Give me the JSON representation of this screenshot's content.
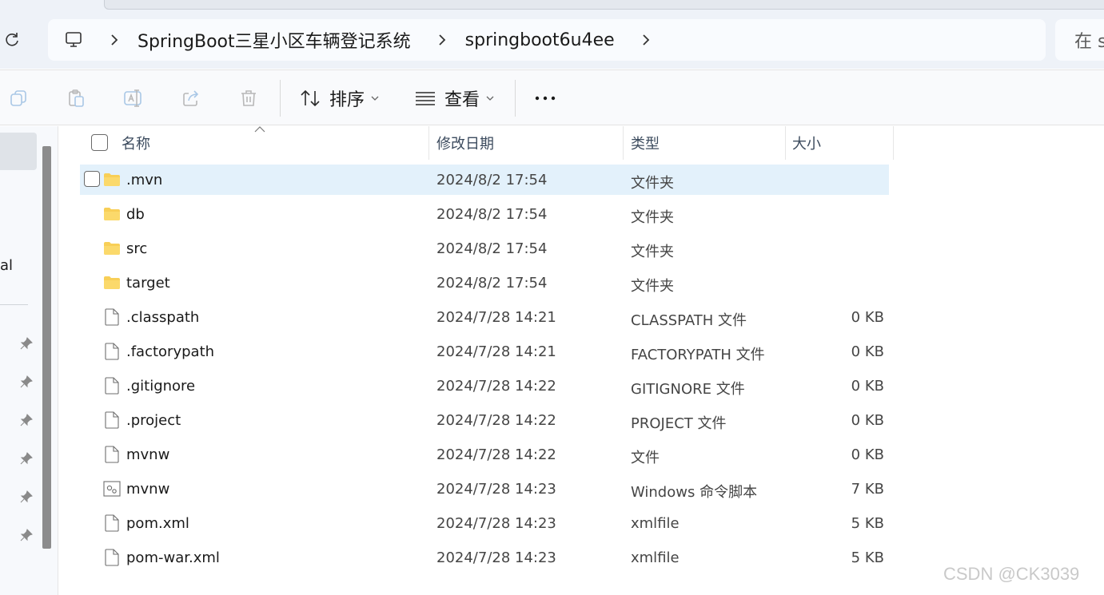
{
  "address": {
    "breadcrumbs": [
      "SpringBoot三星小区车辆登记系统",
      "springboot6u4ee"
    ],
    "search_prefix": "在 s"
  },
  "toolbar": {
    "sort_label": "排序",
    "view_label": "查看",
    "more_label": "···"
  },
  "nav": {
    "partial_text": "al"
  },
  "columns": {
    "name": "名称",
    "date": "修改日期",
    "type": "类型",
    "size": "大小"
  },
  "files": [
    {
      "name": ".mvn",
      "date": "2024/8/2 17:54",
      "type": "文件夹",
      "size": "",
      "kind": "folder-icon",
      "selected": true
    },
    {
      "name": "db",
      "date": "2024/8/2 17:54",
      "type": "文件夹",
      "size": "",
      "kind": "folder-icon"
    },
    {
      "name": "src",
      "date": "2024/8/2 17:54",
      "type": "文件夹",
      "size": "",
      "kind": "folder-icon"
    },
    {
      "name": "target",
      "date": "2024/8/2 17:54",
      "type": "文件夹",
      "size": "",
      "kind": "folder-icon"
    },
    {
      "name": ".classpath",
      "date": "2024/7/28 14:21",
      "type": "CLASSPATH 文件",
      "size": "0 KB",
      "kind": "file-icon"
    },
    {
      "name": ".factorypath",
      "date": "2024/7/28 14:21",
      "type": "FACTORYPATH 文件",
      "size": "0 KB",
      "kind": "file-icon"
    },
    {
      "name": ".gitignore",
      "date": "2024/7/28 14:22",
      "type": "GITIGNORE 文件",
      "size": "0 KB",
      "kind": "file-icon"
    },
    {
      "name": ".project",
      "date": "2024/7/28 14:22",
      "type": "PROJECT 文件",
      "size": "0 KB",
      "kind": "file-icon"
    },
    {
      "name": "mvnw",
      "date": "2024/7/28 14:22",
      "type": "文件",
      "size": "0 KB",
      "kind": "file-icon"
    },
    {
      "name": "mvnw",
      "date": "2024/7/28 14:23",
      "type": "Windows 命令脚本",
      "size": "7 KB",
      "kind": "script-icon"
    },
    {
      "name": "pom.xml",
      "date": "2024/7/28 14:23",
      "type": "xmlfile",
      "size": "5 KB",
      "kind": "file-icon"
    },
    {
      "name": "pom-war.xml",
      "date": "2024/7/28 14:23",
      "type": "xmlfile",
      "size": "5 KB",
      "kind": "file-icon"
    }
  ],
  "watermark": "CSDN @CK3039"
}
